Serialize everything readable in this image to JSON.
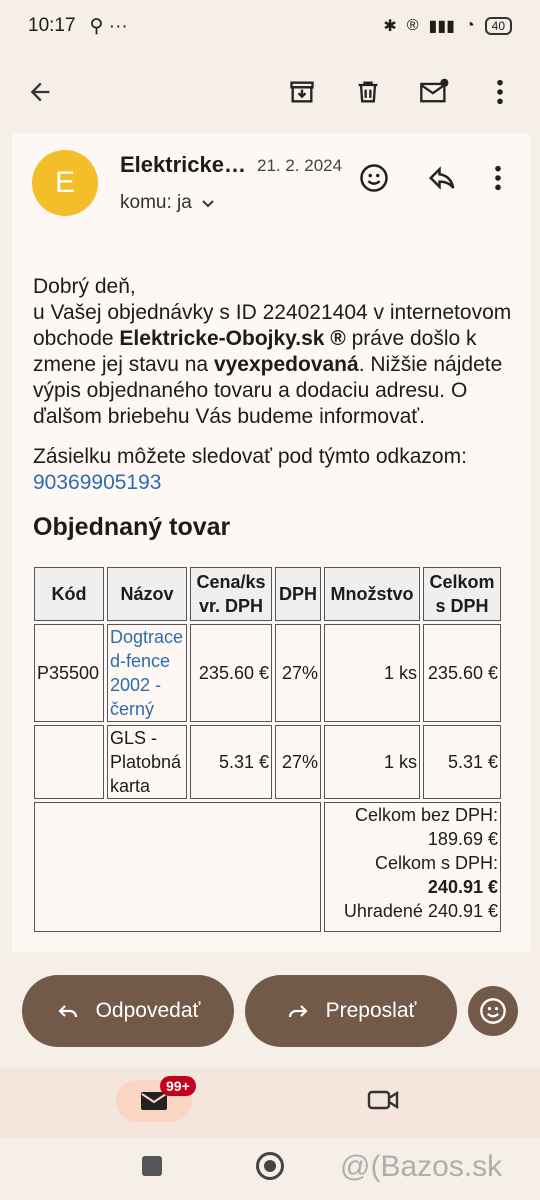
{
  "status_bar": {
    "time": "10:17",
    "extra_icons": "⚲ ···",
    "battery": "40"
  },
  "sender": {
    "avatar_letter": "E",
    "name": "Elektricke-Obojky.sk",
    "date": "21. 2. 2024",
    "to_label": "komu: ja"
  },
  "message": {
    "greeting": "Dobrý deň,",
    "p1_a": "u Vašej objednávky s ID 224021404 v internetovom obchode ",
    "p1_shop": "Elektricke-Obojky.sk ®",
    "p1_b": " práve došlo k zmene jej stavu na ",
    "p1_status": "vyexpedovaná",
    "p1_c": ". Nižšie nájdete výpis objednaného tovaru a dodaciu adresu. O ďalšom briebehu Vás budeme informovať.",
    "tracking_text": "Zásielku môžete sledovať pod týmto odkazom:",
    "tracking_link": "90369905193",
    "section_title": "Objednaný tovar"
  },
  "order_table": {
    "headers": [
      "Kód",
      "Názov",
      "Cena/ks vr. DPH",
      "DPH",
      "Množstvo",
      "Celkom s DPH"
    ],
    "rows": [
      {
        "code": "P35500",
        "name": "Dogtrace d-fence 2002 - černý",
        "price": "235.60 €",
        "vat": "27%",
        "qty": "1 ks",
        "total": "235.60 €"
      },
      {
        "code": "",
        "name": "GLS - Platobná karta",
        "price": "5.31 €",
        "vat": "27%",
        "qty": "1 ks",
        "total": "5.31 €"
      }
    ],
    "summary": {
      "no_vat_label": "Celkom bez DPH:",
      "no_vat_value": "189.69 €",
      "with_vat_label": "Celkom s DPH:",
      "with_vat_value": "240.91 €",
      "paid": "Uhradené 240.91 €"
    }
  },
  "actions": {
    "reply": "Odpovedať",
    "forward": "Preposlať"
  },
  "nav": {
    "mail_badge": "99+"
  },
  "watermark": "@(Bazos.sk"
}
